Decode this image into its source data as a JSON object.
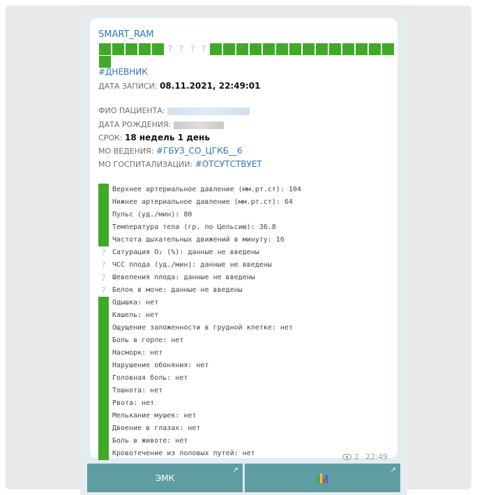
{
  "message": {
    "sender": "SMART_RAM",
    "status_squares_pattern": "GGGGG????GGGGGGGGGGGGGG",
    "hashtag": "#ДНЕВНИК",
    "record_date": {
      "label": "ДАТА ЗАПИСИ:",
      "value": "08.11.2021, 22:49:01"
    },
    "patient_name": {
      "label": "ФИО ПАЦИЕНТА:"
    },
    "birth_date": {
      "label": "ДАТА РОЖДЕНИЯ:"
    },
    "term": {
      "label": "СРОК:",
      "value": "18 недель 1 день"
    },
    "mo_lead": {
      "label": "МО ВЕДЕНИЯ:",
      "value": "#ГБУЗ_СО_ЦГКБ__6"
    },
    "mo_hosp": {
      "label": "МО ГОСПИТАЛИЗАЦИИ:",
      "value": "#ОТСУТСТВУЕТ"
    },
    "rows": [
      {
        "status": "green",
        "text": "Верхнее артериальное давление (мм.рт.ст): 104"
      },
      {
        "status": "green",
        "text": "Нижнее артериальное давление (мм.рт.ст): 64"
      },
      {
        "status": "green",
        "text": "Пульс (уд./мин): 80"
      },
      {
        "status": "green",
        "text": "Температура тела (гр. по Цельсию): 36.8"
      },
      {
        "status": "green",
        "text": "Частота дыхательных движений в минуту: 16"
      },
      {
        "status": "unknown",
        "text": "Сатурация O₂ (%): данные не введены"
      },
      {
        "status": "unknown",
        "text": "ЧСС плода (уд./мин): данные не введены"
      },
      {
        "status": "unknown",
        "text": "Шевеления плода: данные не введены"
      },
      {
        "status": "unknown",
        "text": "Белок в моче: данные не введены"
      },
      {
        "status": "green",
        "text": "Одышка: нет"
      },
      {
        "status": "green",
        "text": "Кашель: нет"
      },
      {
        "status": "green",
        "text": "Ощущение заложенности в грудной клетке: нет"
      },
      {
        "status": "green",
        "text": "Боль в горле: нет"
      },
      {
        "status": "green",
        "text": "Насморк: нет"
      },
      {
        "status": "green",
        "text": "Нарушение обоняния: нет"
      },
      {
        "status": "green",
        "text": "Головная боль: нет"
      },
      {
        "status": "green",
        "text": "Тошнота: нет"
      },
      {
        "status": "green",
        "text": "Рвота: нет"
      },
      {
        "status": "green",
        "text": "Мелькание мушек: нет"
      },
      {
        "status": "green",
        "text": "Двоение в глазах: нет"
      },
      {
        "status": "green",
        "text": "Боль в животе: нет"
      },
      {
        "status": "green",
        "text": "Кровотечение из половых путей: нет"
      }
    ],
    "views": "2",
    "time": "22:49"
  },
  "buttons": {
    "emk": "ЭМК",
    "chart_icon": "bar-chart-icon"
  },
  "colors": {
    "green": "#3faa27",
    "link": "#2f77b9",
    "button": "#5e9da2"
  }
}
